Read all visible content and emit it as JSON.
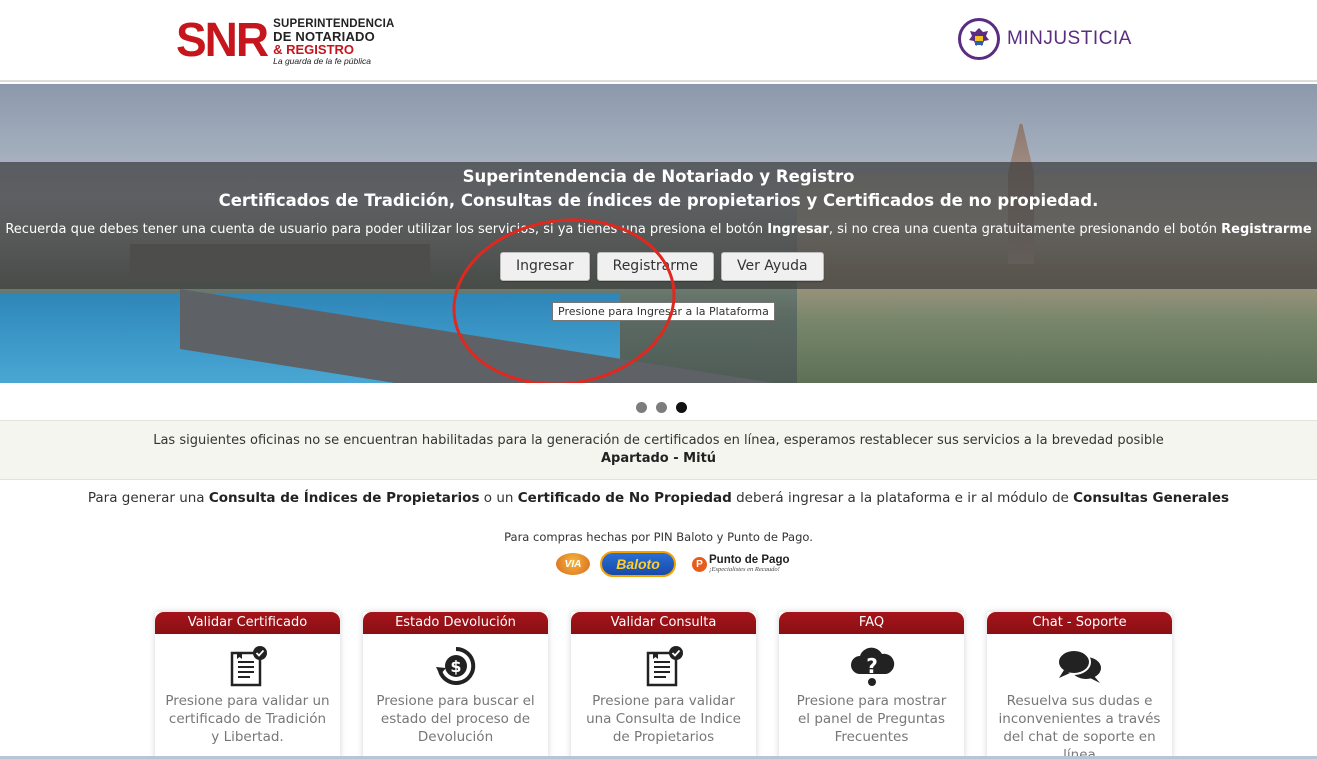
{
  "header": {
    "snr": {
      "letters": "SNR",
      "line1": "SUPERINTENDENCIA",
      "line2": "DE NOTARIADO",
      "line3": "& REGISTRO",
      "line4": "La guarda de la fe pública"
    },
    "minjusticia": "MINJUSTICIA"
  },
  "hero": {
    "title1": "Superintendencia de Notariado y Registro",
    "title2": "Certificados de Tradición, Consultas de índices de propietarios y Certificados de no propiedad.",
    "note_a": "Recuerda que debes tener una cuenta de usuario para poder utilizar los servicios, si ya tienes una presiona el botón ",
    "note_b": "Ingresar",
    "note_c": ", si no crea una cuenta gratuitamente presionando el botón ",
    "note_d": "Registrarme",
    "buttons": {
      "ingresar": "Ingresar",
      "registrarme": "Registrarme",
      "ayuda": "Ver Ayuda"
    },
    "tooltip": "Presione para Ingresar a la Plataforma"
  },
  "carousel": {
    "active_index": 2,
    "count": 3
  },
  "notice": {
    "line1": "Las siguientes oficinas no se encuentran habilitadas para la generación de certificados en línea, esperamos restablecer sus servicios a la brevedad posible",
    "line2": "Apartado - Mitú"
  },
  "info": {
    "a": "Para generar una ",
    "b": "Consulta de Índices de Propietarios",
    "c": " o un ",
    "d": "Certificado de No Propiedad",
    "e": " deberá ingresar a la plataforma e ir al módulo de ",
    "f": "Consultas Generales"
  },
  "payments": {
    "text": "Para compras hechas por PIN Baloto y Punto de Pago.",
    "via": "VIA",
    "baloto": "Baloto",
    "puntopago": "Punto de Pago",
    "puntopago_tagline": "¡Especialistes en Recaudo!"
  },
  "cards": [
    {
      "title": "Validar Certificado",
      "icon": "certificate-icon",
      "text": "Presione para validar un certificado de Tradición y Libertad."
    },
    {
      "title": "Estado Devolución",
      "icon": "refund-icon",
      "text": "Presione para buscar el estado del proceso de Devolución"
    },
    {
      "title": "Validar Consulta",
      "icon": "certificate-icon",
      "text": "Presione para validar una Consulta de Indice de Propietarios"
    },
    {
      "title": "FAQ",
      "icon": "cloud-question-icon",
      "text": "Presione para mostrar el panel de Preguntas Frecuentes"
    },
    {
      "title": "Chat - Soporte",
      "icon": "chat-icon",
      "text": "Resuelva sus dudas e inconvenientes a través del chat de soporte en línea"
    }
  ],
  "colors": {
    "brand_red": "#8a0f14",
    "snr_red": "#c4161c",
    "minj_purple": "#5b2d82"
  }
}
